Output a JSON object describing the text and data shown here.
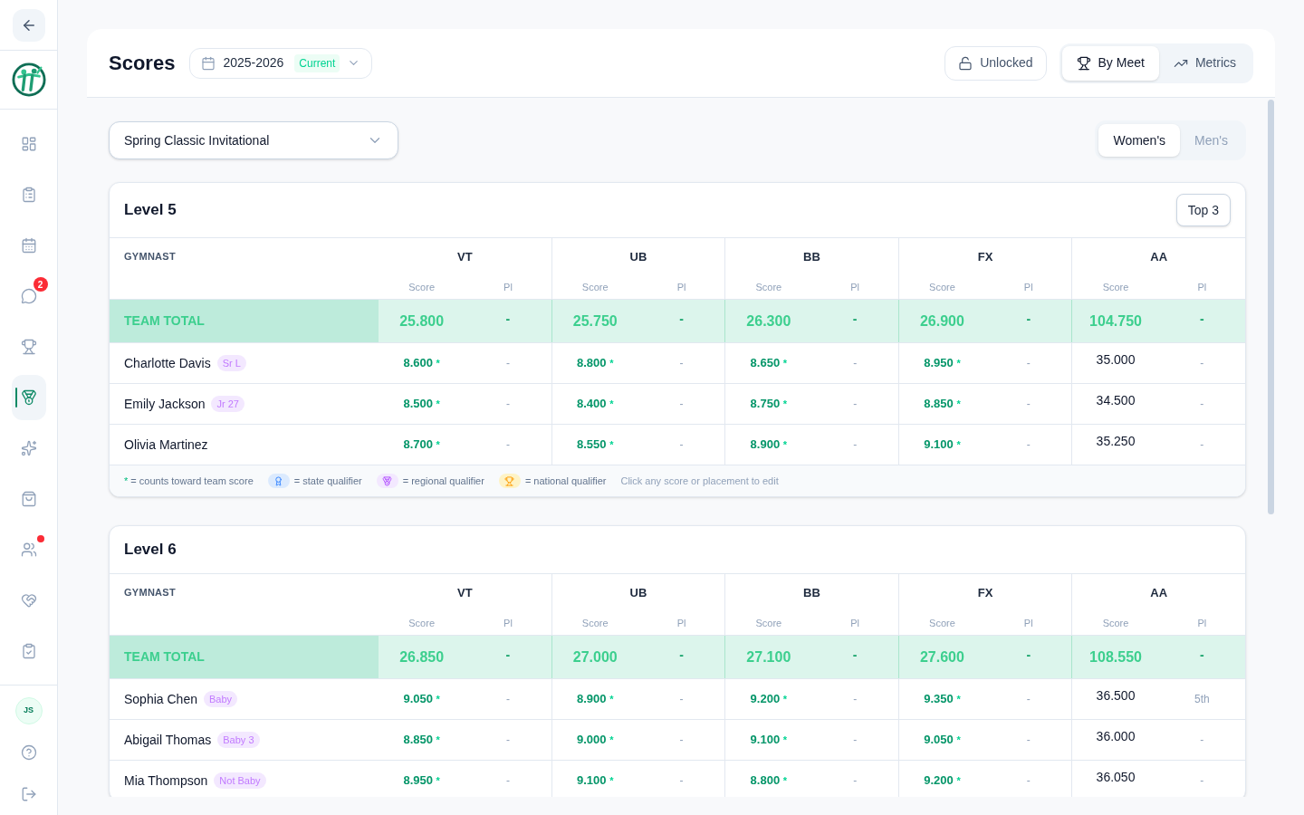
{
  "sidebar": {
    "nav": [
      {
        "selected": false,
        "alert": false
      },
      {
        "selected": false,
        "alert": false
      },
      {
        "selected": false,
        "alert": false
      },
      {
        "selected": false,
        "alert": false,
        "badge": "2"
      },
      {
        "selected": false,
        "alert": false
      },
      {
        "selected": true,
        "alert": false
      },
      {
        "selected": false,
        "alert": false
      },
      {
        "selected": false,
        "alert": false
      },
      {
        "selected": false,
        "alert": true
      },
      {
        "selected": false,
        "alert": false
      },
      {
        "selected": false,
        "alert": false
      }
    ],
    "avatar": "JS"
  },
  "header": {
    "title": "Scores",
    "season": {
      "value": "2025-2026",
      "badge": "Current"
    },
    "lock_button": "Unlocked",
    "view_tabs": [
      {
        "label": "By Meet",
        "selected": true
      },
      {
        "label": "Metrics",
        "selected": false
      }
    ]
  },
  "meet_select": {
    "value": "Spring Classic Invitational"
  },
  "gender_tabs": [
    {
      "label": "Women's",
      "selected": true
    },
    {
      "label": "Men's",
      "selected": false
    }
  ],
  "levels": [
    {
      "title": "Level 5",
      "top_button": "Top 3",
      "gymnast_header": "GYMNAST",
      "events": [
        {
          "name": "VT",
          "kind": "event",
          "score_label": "Score",
          "place_label": "Pl"
        },
        {
          "name": "UB",
          "kind": "event",
          "score_label": "Score",
          "place_label": "Pl"
        },
        {
          "name": "BB",
          "kind": "event",
          "score_label": "Score",
          "place_label": "Pl"
        },
        {
          "name": "FX",
          "kind": "event",
          "score_label": "Score",
          "place_label": "Pl"
        },
        {
          "name": "AA",
          "kind": "all_around",
          "score_label": "Score",
          "place_label": "Pl"
        }
      ],
      "team_total": {
        "label": "TEAM TOTAL",
        "cells": [
          {
            "score": "25.800",
            "place": "-"
          },
          {
            "score": "25.750",
            "place": "-"
          },
          {
            "score": "26.300",
            "place": "-"
          },
          {
            "score": "26.900",
            "place": "-"
          },
          {
            "score": "104.750",
            "place": "-"
          }
        ]
      },
      "rows": [
        {
          "name": "Charlotte Davis",
          "tag": "Sr L",
          "cells": [
            {
              "score": "8.600",
              "mark": "*",
              "place": "-"
            },
            {
              "score": "8.800",
              "mark": "*",
              "place": "-"
            },
            {
              "score": "8.650",
              "mark": "*",
              "place": "-"
            },
            {
              "score": "8.950",
              "mark": "*",
              "place": "-"
            },
            {
              "score": "35.000",
              "place": "-"
            }
          ]
        },
        {
          "name": "Emily Jackson",
          "tag": "Jr 27",
          "cells": [
            {
              "score": "8.500",
              "mark": "*",
              "place": "-"
            },
            {
              "score": "8.400",
              "mark": "*",
              "place": "-"
            },
            {
              "score": "8.750",
              "mark": "*",
              "place": "-"
            },
            {
              "score": "8.850",
              "mark": "*",
              "place": "-"
            },
            {
              "score": "34.500",
              "place": "-"
            }
          ]
        },
        {
          "name": "Olivia Martinez",
          "cells": [
            {
              "score": "8.700",
              "mark": "*",
              "place": "-"
            },
            {
              "score": "8.550",
              "mark": "*",
              "place": "-"
            },
            {
              "score": "8.900",
              "mark": "*",
              "place": "-"
            },
            {
              "score": "9.100",
              "mark": "*",
              "place": "-"
            },
            {
              "score": "35.250",
              "place": "-"
            }
          ]
        }
      ],
      "legend": {
        "items": [
          {
            "kind": "counts",
            "mark": "*",
            "label": "= counts toward team score"
          },
          {
            "kind": "state",
            "label": "= state qualifier"
          },
          {
            "kind": "regional",
            "label": "= regional qualifier"
          },
          {
            "kind": "national",
            "label": "= national qualifier"
          }
        ],
        "hint": "Click any score or placement to edit"
      }
    },
    {
      "title": "Level 6",
      "gymnast_header": "GYMNAST",
      "events": [
        {
          "name": "VT",
          "kind": "event",
          "score_label": "Score",
          "place_label": "Pl"
        },
        {
          "name": "UB",
          "kind": "event",
          "score_label": "Score",
          "place_label": "Pl"
        },
        {
          "name": "BB",
          "kind": "event",
          "score_label": "Score",
          "place_label": "Pl"
        },
        {
          "name": "FX",
          "kind": "event",
          "score_label": "Score",
          "place_label": "Pl"
        },
        {
          "name": "AA",
          "kind": "all_around",
          "score_label": "Score",
          "place_label": "Pl"
        }
      ],
      "team_total": {
        "label": "TEAM TOTAL",
        "cells": [
          {
            "score": "26.850",
            "place": "-"
          },
          {
            "score": "27.000",
            "place": "-"
          },
          {
            "score": "27.100",
            "place": "-"
          },
          {
            "score": "27.600",
            "place": "-"
          },
          {
            "score": "108.550",
            "place": "-"
          }
        ]
      },
      "rows": [
        {
          "name": "Sophia Chen",
          "tag": "Baby",
          "cells": [
            {
              "score": "9.050",
              "mark": "*",
              "place": "-"
            },
            {
              "score": "8.900",
              "mark": "*",
              "place": "-"
            },
            {
              "score": "9.200",
              "mark": "*",
              "place": "-"
            },
            {
              "score": "9.350",
              "mark": "*",
              "place": "-"
            },
            {
              "score": "36.500",
              "place": "5th"
            }
          ]
        },
        {
          "name": "Abigail Thomas",
          "tag": "Baby 3",
          "cells": [
            {
              "score": "8.850",
              "mark": "*",
              "place": "-"
            },
            {
              "score": "9.000",
              "mark": "*",
              "place": "-"
            },
            {
              "score": "9.100",
              "mark": "*",
              "place": "-"
            },
            {
              "score": "9.050",
              "mark": "*",
              "place": "-"
            },
            {
              "score": "36.000",
              "place": "-"
            }
          ]
        },
        {
          "name": "Mia Thompson",
          "tag": "Not Baby",
          "cells": [
            {
              "score": "8.950",
              "mark": "*",
              "place": "-"
            },
            {
              "score": "9.100",
              "mark": "*",
              "place": "-"
            },
            {
              "score": "8.800",
              "mark": "*",
              "place": "-"
            },
            {
              "score": "9.200",
              "mark": "*",
              "place": "-"
            },
            {
              "score": "36.050",
              "place": "-"
            }
          ]
        }
      ]
    }
  ]
}
